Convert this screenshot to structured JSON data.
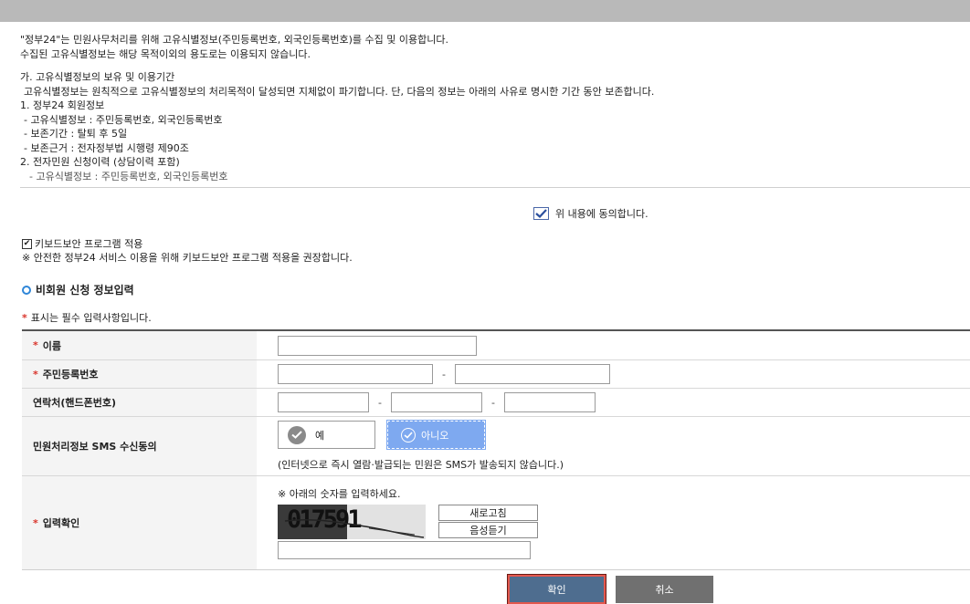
{
  "terms": {
    "lines": [
      "\"정부24\"는 민원사무처리를 위해 고유식별정보(주민등록번호, 외국인등록번호)를 수집 및 이용합니다.",
      "수집된 고유식별정보는 해당 목적이외의 용도로는 이용되지 않습니다.",
      "가. 고유식별정보의 보유 및 이용기간",
      "고유식별정보는 원칙적으로 고유식별정보의 처리목적이 달성되면 지체없이 파기합니다. 단, 다음의 정보는 아래의 사유로 명시한 기간 동안 보존합니다.",
      "1. 정부24 회원정보",
      "- 고유식별정보 : 주민등록번호, 외국인등록번호",
      "- 보존기간 : 탈퇴 후 5일",
      "- 보존근거 : 전자정부법 시행령 제90조",
      "2. 전자민원 신청이력 (상담이력 포함)",
      "- 고유식별정보 : 주민등록번호, 외국인등록번호"
    ]
  },
  "agree": {
    "label": "위 내용에 동의합니다.",
    "checked": true
  },
  "keyboard_security": {
    "label": "키보드보안 프로그램 적용",
    "checked": true,
    "note": "※ 안전한 정부24 서비스 이용을 위해 키보드보안 프로그램 적용을 권장합니다."
  },
  "section_title": "비회원 신청 정보입력",
  "required_mark": "*",
  "required_note": "표시는 필수 입력사항입니다.",
  "form": {
    "name_label": "이름",
    "rrn_label": "주민등록번호",
    "phone_label": "연락처(핸드폰번호)",
    "sms_label": "민원처리정보 SMS 수신동의",
    "captcha_label": "입력확인",
    "dash": "-",
    "sms_yes": "예",
    "sms_no": "아니오",
    "sms_selected": "아니오",
    "sms_note": "(인터넷으로 즉시 열람·발급되는 민원은 SMS가 발송되지 않습니다.)",
    "captcha_hint": "※ 아래의 숫자를 입력하세요.",
    "captcha_text": "017591",
    "refresh_label": "새로고침",
    "audio_label": "음성듣기"
  },
  "buttons": {
    "confirm": "확인",
    "cancel": "취소"
  },
  "colors": {
    "accent": "#2f86d8",
    "required": "#d9342b",
    "selected": "#7ea9f0",
    "confirm_bg": "#4e6d8f",
    "cancel_bg": "#707070"
  }
}
